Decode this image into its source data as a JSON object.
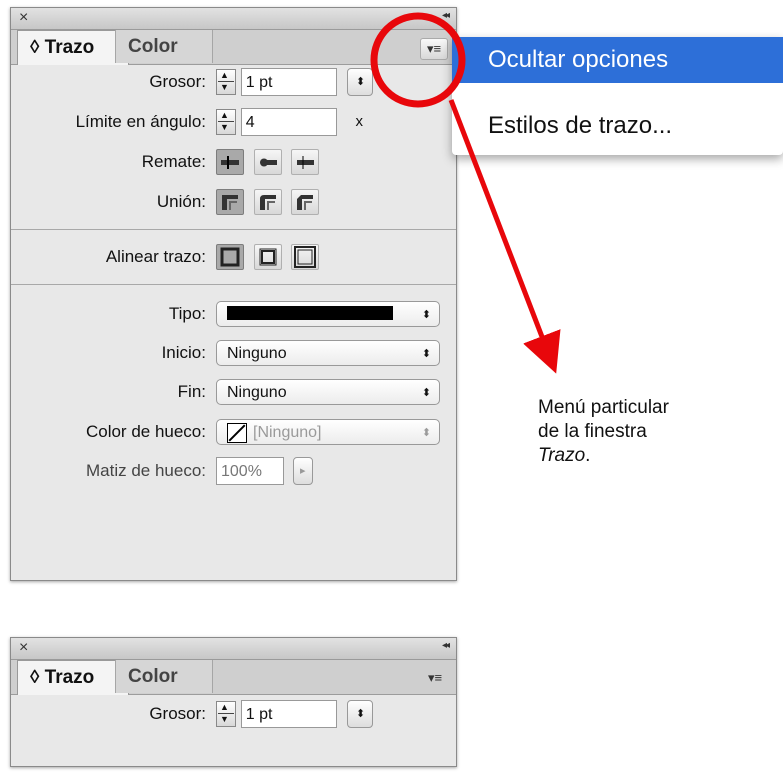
{
  "panel_full": {
    "tabs": [
      "◊ Trazo",
      "Color"
    ],
    "grosor_label": "Grosor:",
    "grosor_value": "1 pt",
    "limite_label": "Límite en ángulo:",
    "limite_value": "4",
    "limite_unit": "x",
    "remate_label": "Remate:",
    "union_label": "Unión:",
    "alinear_label": "Alinear trazo:",
    "tipo_label": "Tipo:",
    "inicio_label": "Inicio:",
    "inicio_value": "Ninguno",
    "fin_label": "Fin:",
    "fin_value": "Ninguno",
    "color_hueco_label": "Color de hueco:",
    "color_hueco_value": "[Ninguno]",
    "matiz_label": "Matiz de hueco:",
    "matiz_value": "100%"
  },
  "menu": {
    "items": [
      "Ocultar opciones",
      "Estilos de trazo..."
    ]
  },
  "caption": {
    "line1": "Menú particular",
    "line2": "de la finestra",
    "line3": "Trazo",
    "line3_suffix": "."
  },
  "panel_small": {
    "tabs": [
      "◊ Trazo",
      "Color"
    ],
    "grosor_label": "Grosor:",
    "grosor_value": "1 pt"
  },
  "colors": {
    "highlight": "#2d6fd8",
    "annotation_red": "#e8070b"
  }
}
